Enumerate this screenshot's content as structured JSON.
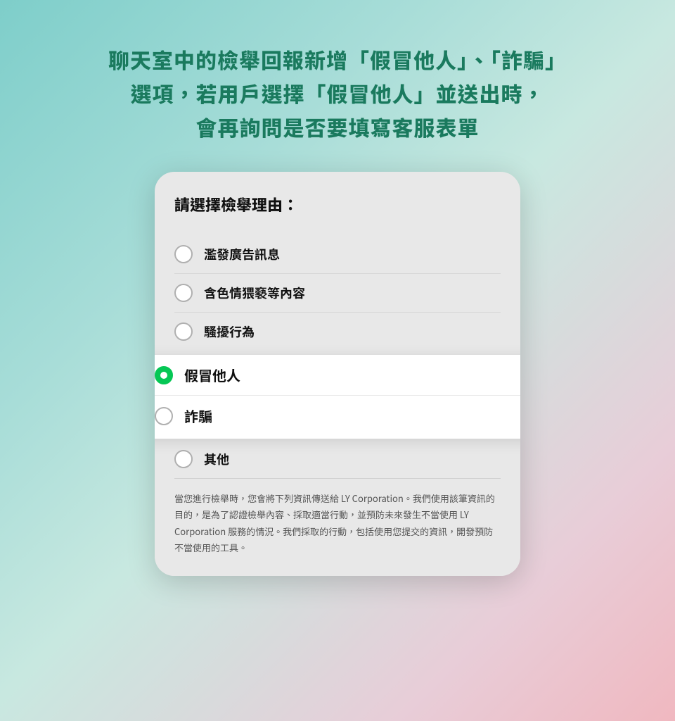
{
  "background": {
    "gradient_start": "#7ececa",
    "gradient_end": "#f0b8c0"
  },
  "headline": {
    "line1": "聊天室中的檢舉回報新增「假冒他人」、「詐騙」",
    "line2": "選項，若用戶選擇「假冒他人」並送出時，",
    "line3": "會再詢問是否要填寫客服表單"
  },
  "form": {
    "section_title": "請選擇檢舉理由：",
    "options": [
      {
        "id": "spam",
        "label": "濫發廣告訊息",
        "selected": false
      },
      {
        "id": "adult",
        "label": "含色情猥褻等內容",
        "selected": false
      },
      {
        "id": "harass",
        "label": "騷擾行為",
        "selected": false
      },
      {
        "id": "impersonate",
        "label": "假冒他人",
        "selected": true,
        "elevated": true
      },
      {
        "id": "fraud",
        "label": "詐騙",
        "selected": false,
        "elevated": true
      },
      {
        "id": "other",
        "label": "其他",
        "selected": false
      }
    ],
    "disclaimer": "當您進行檢舉時，您會將下列資訊傳送給 LY Corporation。我們使用該筆資訊的目的，是為了認證檢舉內容、採取適當行動，並預防未來發生不當使用 LY Corporation 服務的情況。我們採取的行動，包括使用您提交的資訊，開發預防不當使用的工具。"
  }
}
